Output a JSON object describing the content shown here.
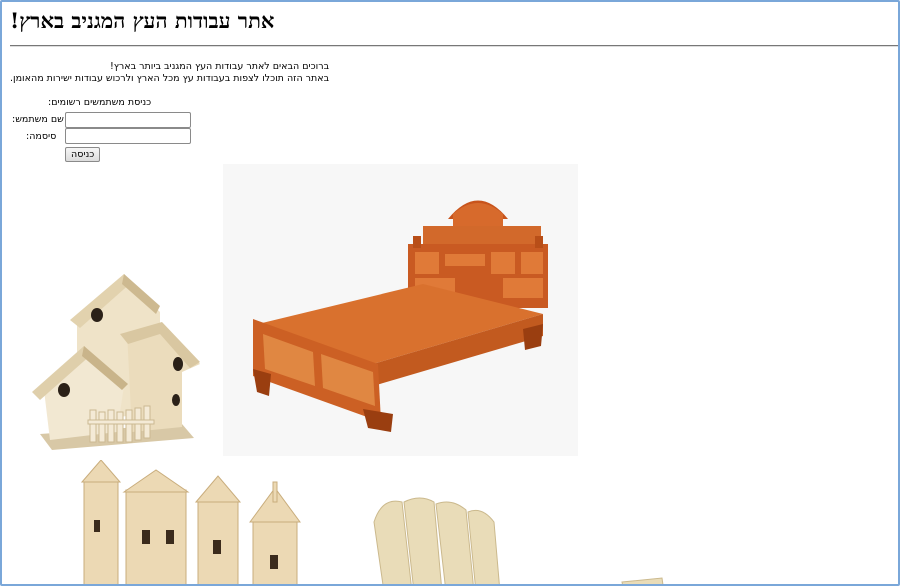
{
  "page": {
    "title": "אתר עבודות העץ המגניב בארץ!",
    "intro_line1": "ברוכים הבאים לאתר עבודות העץ המגניב ביותר בארץ!",
    "intro_line2": "באתר הזה תוכלו לצפות בעבודות עץ מכל הארץ ולרכוש עבודות ישירות מהאומן."
  },
  "login": {
    "heading": "כניסת משתמשים רשומים:",
    "username_label": "שם משתמש:",
    "password_label": "סיסמה:",
    "username_value": "",
    "password_value": "",
    "submit_label": "כניסה"
  },
  "images": [
    {
      "name": "birdhouse",
      "alt": ""
    },
    {
      "name": "carved-bed",
      "alt": ""
    },
    {
      "name": "wooden-castle",
      "alt": ""
    },
    {
      "name": "adirondack-chair",
      "alt": ""
    }
  ],
  "colors": {
    "frame_border": "#7aa7d9",
    "wood_light": "#e9dcc0",
    "wood_orange": "#d2692b"
  }
}
